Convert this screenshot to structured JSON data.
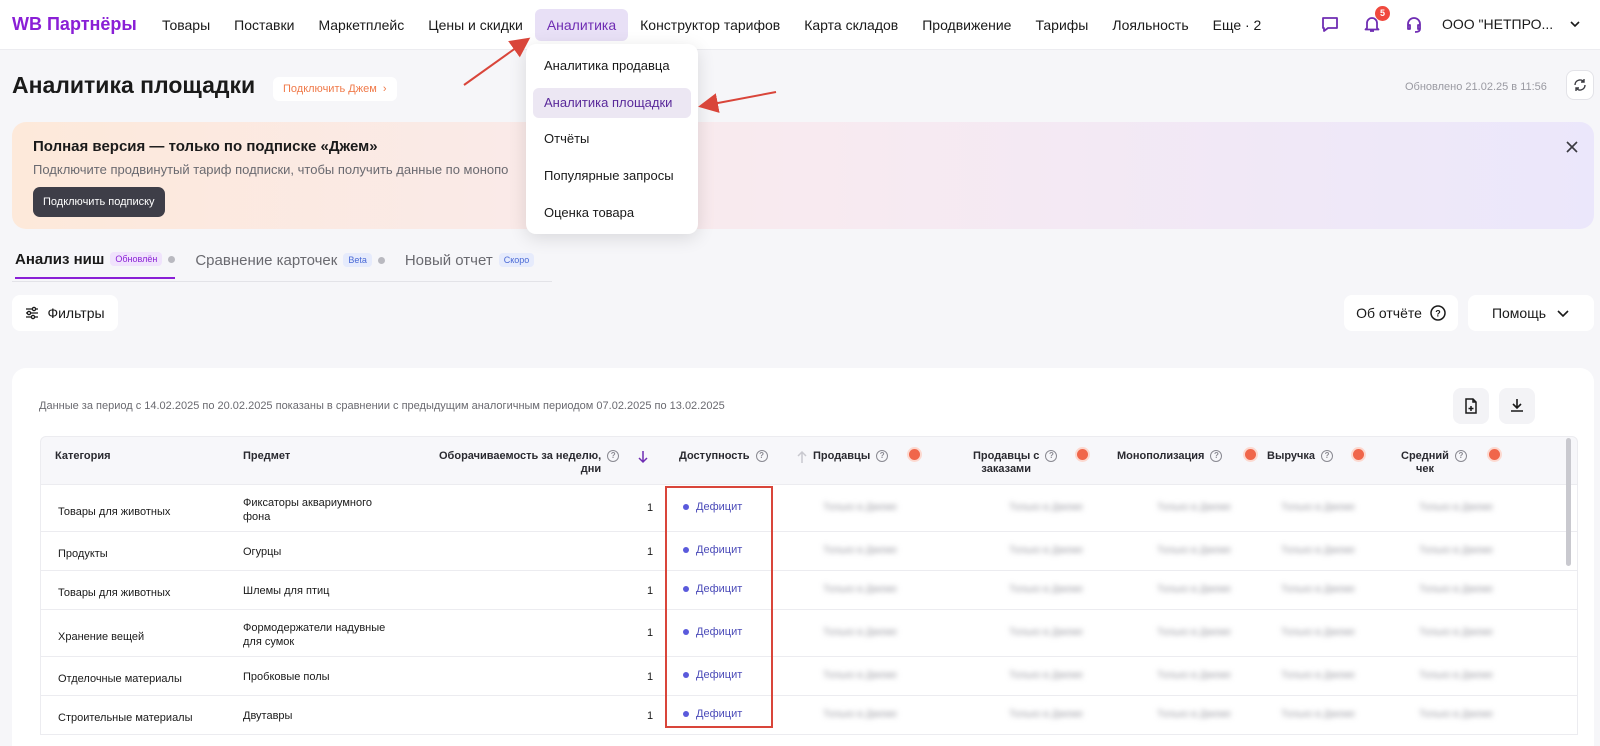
{
  "app": {
    "logo": "WB Партнёры"
  },
  "nav": {
    "items": [
      "Товары",
      "Поставки",
      "Маркетплейс",
      "Цены и скидки",
      "Аналитика",
      "Конструктор тарифов",
      "Карта складов",
      "Продвижение",
      "Тарифы",
      "Лояльность",
      "Еще · 2"
    ],
    "active": "Аналитика",
    "notifications_count": "5",
    "org": "ООО \"НЕТПРО..."
  },
  "dropdown": {
    "items": [
      "Аналитика продавца",
      "Аналитика площадки",
      "Отчёты",
      "Популярные запросы",
      "Оценка товара"
    ],
    "active": "Аналитика площадки"
  },
  "header": {
    "title": "Аналитика площадки",
    "jam_link": "Подключить Джем",
    "updated": "Обновлено 21.02.25 в 11:56"
  },
  "banner": {
    "title": "Полная версия — только по подписке «Джем»",
    "text": "Подключите продвинутый тариф подписки, чтобы получить данные по монопо",
    "button": "Подключить подписку"
  },
  "tabs": [
    {
      "label": "Анализ ниш",
      "badge": "Обновлён"
    },
    {
      "label": "Сравнение карточек",
      "badge": "Beta"
    },
    {
      "label": "Новый отчет",
      "badge": "Скоро"
    }
  ],
  "toolbar": {
    "filters": "Фильтры",
    "about": "Об отчёте",
    "help": "Помощь"
  },
  "report": {
    "period": "Данные за период с 14.02.2025 по 20.02.2025 показаны в сравнении с предыдущим аналогичным периодом 07.02.2025 по 13.02.2025",
    "columns": {
      "category": "Категория",
      "subject": "Предмет",
      "turnover_1": "Оборачиваемость за неделю,",
      "turnover_2": "дни",
      "availability": "Доступность",
      "sellers": "Продавцы",
      "sellers_orders_1": "Продавцы с",
      "sellers_orders_2": "заказами",
      "monopoly": "Монополизация",
      "revenue": "Выручка",
      "avg_1": "Средний",
      "avg_2": "чек"
    },
    "locked_text": "Только в Джеме",
    "rows": [
      {
        "category": "Товары для животных",
        "subject": "Фиксаторы аквариумного фона",
        "turnover": "1",
        "availability": "Дефицит"
      },
      {
        "category": "Продукты",
        "subject": "Огурцы",
        "turnover": "1",
        "availability": "Дефицит"
      },
      {
        "category": "Товары для животных",
        "subject": "Шлемы для птиц",
        "turnover": "1",
        "availability": "Дефицит"
      },
      {
        "category": "Хранение вещей",
        "subject": "Формодержатели надувные для сумок",
        "turnover": "1",
        "availability": "Дефицит"
      },
      {
        "category": "Отделочные материалы",
        "subject": "Пробковые полы",
        "turnover": "1",
        "availability": "Дефицит"
      },
      {
        "category": "Строительные материалы",
        "subject": "Двутавры",
        "turnover": "1",
        "availability": "Дефицит"
      }
    ]
  },
  "colors": {
    "brand": "#8a1fd6",
    "annotation": "#d9453a",
    "deficit": "#4a4ab8"
  }
}
